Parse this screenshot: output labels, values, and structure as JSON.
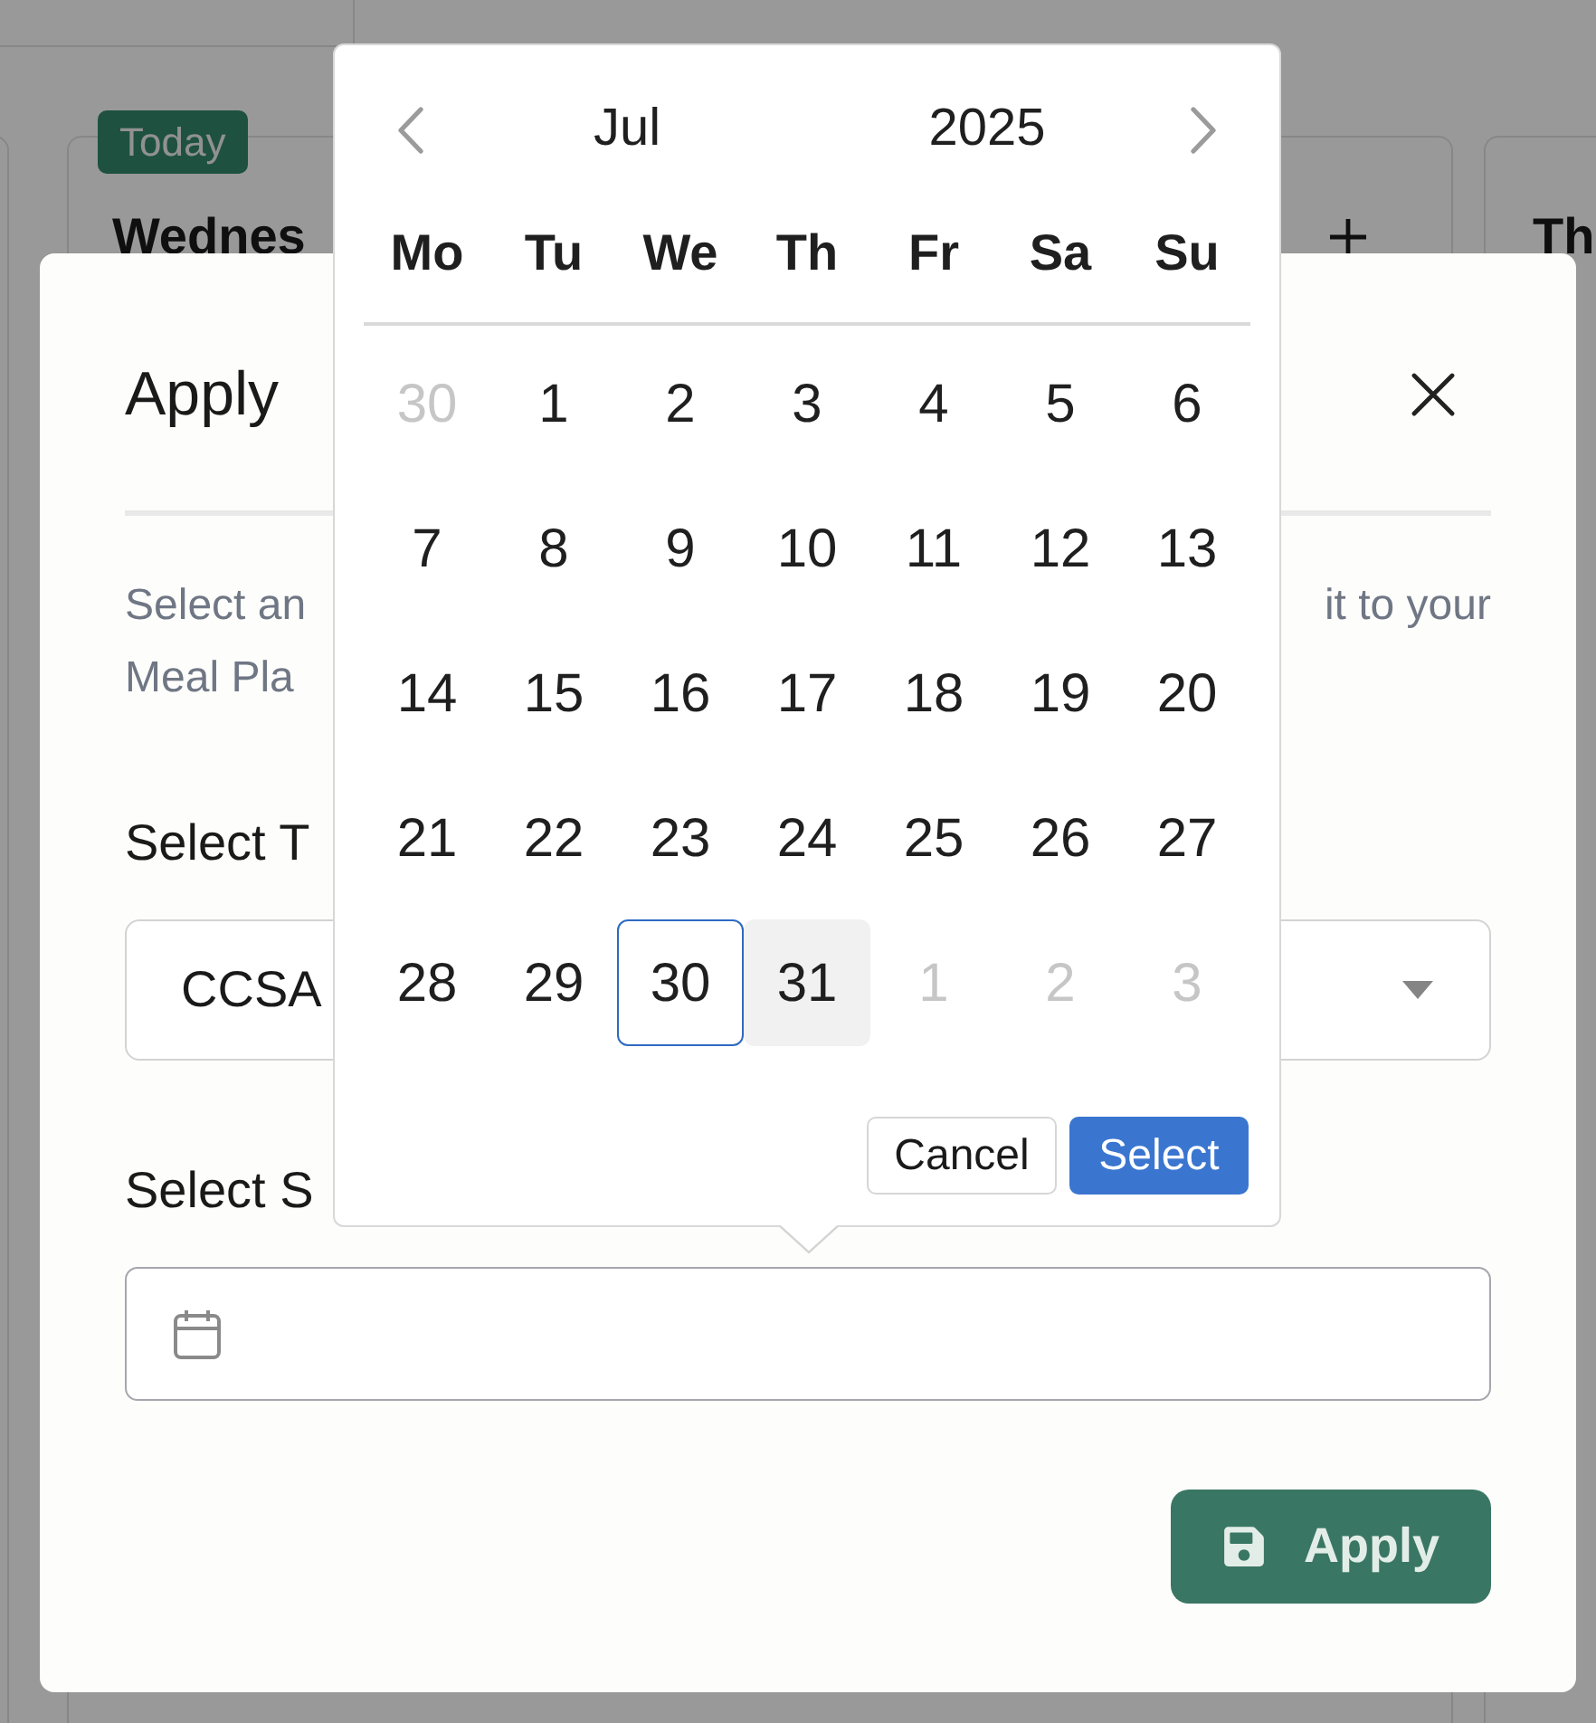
{
  "board": {
    "day_columns": [
      {
        "badge": "Today",
        "title": "Wednes",
        "add_icon": true
      },
      {
        "title": "Th"
      }
    ]
  },
  "modal": {
    "title": "Apply",
    "description": {
      "line_1_start": "Select an",
      "line_1_end": "it to your",
      "line_2_start": "Meal Pla"
    },
    "template_field": {
      "label": "Select T",
      "value": "CCSA"
    },
    "date_field": {
      "label": "Select S"
    },
    "apply_button": "Apply"
  },
  "date_picker": {
    "month": "Jul",
    "year": "2025",
    "weekdays": [
      "Mo",
      "Tu",
      "We",
      "Th",
      "Fr",
      "Sa",
      "Su"
    ],
    "weeks": [
      [
        {
          "label": "30",
          "in_month": false,
          "today": false,
          "hovered": false,
          "selected": false
        },
        {
          "label": "1",
          "in_month": true,
          "today": false,
          "hovered": false,
          "selected": false
        },
        {
          "label": "2",
          "in_month": true,
          "today": false,
          "hovered": false,
          "selected": false
        },
        {
          "label": "3",
          "in_month": true,
          "today": false,
          "hovered": false,
          "selected": false
        },
        {
          "label": "4",
          "in_month": true,
          "today": false,
          "hovered": false,
          "selected": false
        },
        {
          "label": "5",
          "in_month": true,
          "today": false,
          "hovered": false,
          "selected": false
        },
        {
          "label": "6",
          "in_month": true,
          "today": false,
          "hovered": false,
          "selected": false
        }
      ],
      [
        {
          "label": "7",
          "in_month": true,
          "today": false,
          "hovered": false,
          "selected": false
        },
        {
          "label": "8",
          "in_month": true,
          "today": false,
          "hovered": false,
          "selected": false
        },
        {
          "label": "9",
          "in_month": true,
          "today": false,
          "hovered": false,
          "selected": false
        },
        {
          "label": "10",
          "in_month": true,
          "today": false,
          "hovered": false,
          "selected": false
        },
        {
          "label": "11",
          "in_month": true,
          "today": false,
          "hovered": false,
          "selected": false
        },
        {
          "label": "12",
          "in_month": true,
          "today": false,
          "hovered": false,
          "selected": false
        },
        {
          "label": "13",
          "in_month": true,
          "today": false,
          "hovered": false,
          "selected": false
        }
      ],
      [
        {
          "label": "14",
          "in_month": true,
          "today": false,
          "hovered": false,
          "selected": false
        },
        {
          "label": "15",
          "in_month": true,
          "today": false,
          "hovered": false,
          "selected": false
        },
        {
          "label": "16",
          "in_month": true,
          "today": false,
          "hovered": false,
          "selected": false
        },
        {
          "label": "17",
          "in_month": true,
          "today": false,
          "hovered": false,
          "selected": false
        },
        {
          "label": "18",
          "in_month": true,
          "today": false,
          "hovered": false,
          "selected": false
        },
        {
          "label": "19",
          "in_month": true,
          "today": false,
          "hovered": false,
          "selected": false
        },
        {
          "label": "20",
          "in_month": true,
          "today": false,
          "hovered": false,
          "selected": false
        }
      ],
      [
        {
          "label": "21",
          "in_month": true,
          "today": false,
          "hovered": false,
          "selected": false
        },
        {
          "label": "22",
          "in_month": true,
          "today": false,
          "hovered": false,
          "selected": false
        },
        {
          "label": "23",
          "in_month": true,
          "today": false,
          "hovered": false,
          "selected": false
        },
        {
          "label": "24",
          "in_month": true,
          "today": false,
          "hovered": false,
          "selected": false
        },
        {
          "label": "25",
          "in_month": true,
          "today": false,
          "hovered": false,
          "selected": false
        },
        {
          "label": "26",
          "in_month": true,
          "today": false,
          "hovered": false,
          "selected": false
        },
        {
          "label": "27",
          "in_month": true,
          "today": false,
          "hovered": false,
          "selected": false
        }
      ],
      [
        {
          "label": "28",
          "in_month": true,
          "today": false,
          "hovered": false,
          "selected": false
        },
        {
          "label": "29",
          "in_month": true,
          "today": false,
          "hovered": false,
          "selected": false
        },
        {
          "label": "30",
          "in_month": true,
          "today": true,
          "hovered": false,
          "selected": false
        },
        {
          "label": "31",
          "in_month": true,
          "today": false,
          "hovered": true,
          "selected": false
        },
        {
          "label": "1",
          "in_month": false,
          "today": false,
          "hovered": false,
          "selected": false
        },
        {
          "label": "2",
          "in_month": false,
          "today": false,
          "hovered": false,
          "selected": false
        },
        {
          "label": "3",
          "in_month": false,
          "today": false,
          "hovered": false,
          "selected": false
        }
      ]
    ],
    "cancel_button": "Cancel",
    "select_button": "Select"
  }
}
